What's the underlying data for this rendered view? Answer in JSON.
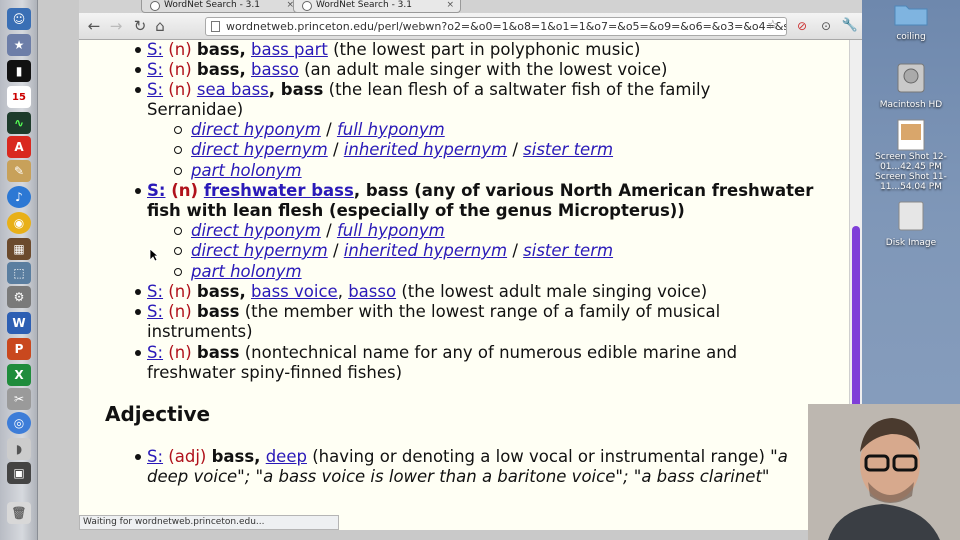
{
  "browser": {
    "tabs": [
      {
        "label": "WordNet Search - 3.1",
        "active": false
      },
      {
        "label": "WordNet Search - 3.1",
        "active": true
      }
    ],
    "url": "wordnetweb.princeton.edu/perl/webwn?o2=&o0=1&o8=1&o1=1&o7=&o5=&o9=&o6=&o3=&o4=&s=bass&i=7&h=00...",
    "status": "Waiting for wordnetweb.princeton.edu..."
  },
  "desktop": {
    "items": [
      {
        "label": "coiling",
        "icon": "folder-icon"
      },
      {
        "label": "Macintosh HD",
        "icon": "hard-drive-icon"
      },
      {
        "label": "Screen Shot 12-01...42.45 PM",
        "icon": "screenshot-icon"
      },
      {
        "label": "Screen Shot 11-11...54.04 PM",
        "icon": "screenshot-icon"
      },
      {
        "label": "Disk Image",
        "icon": "disk-image-icon"
      }
    ]
  },
  "content": {
    "senses": [
      {
        "s": "S:",
        "pos": "(n)",
        "words": "bass,",
        "link": "bass part",
        "gloss": "(the lowest part in polyphonic music)"
      },
      {
        "s": "S:",
        "pos": "(n)",
        "words": "bass,",
        "link": "basso",
        "gloss": "(an adult male singer with the lowest voice)"
      },
      {
        "s": "S:",
        "pos": "(n)",
        "link": "sea bass",
        "words": ", bass",
        "gloss": "(the lean flesh of a saltwater fish of the family",
        "gloss2": "Serranidae)"
      },
      {
        "s": "S:",
        "pos": "(n)",
        "link": "freshwater bass",
        "words": ", bass",
        "gloss": "(any of various North American freshwater",
        "gloss2": "fish with lean flesh (especially of the genus Micropterus))"
      },
      {
        "s": "S:",
        "pos": "(n)",
        "words": "bass,",
        "link": "bass voice",
        "sep": ",",
        "link2": "basso",
        "gloss": "(the lowest adult male singing voice)"
      },
      {
        "s": "S:",
        "pos": "(n)",
        "words": "bass",
        "gloss": "(the member with the lowest range of a family of musical",
        "gloss2": "instruments)"
      },
      {
        "s": "S:",
        "pos": "(n)",
        "words": "bass",
        "gloss": "(nontechnical name for any of numerous edible marine and",
        "gloss2": "freshwater spiny-finned fishes)"
      }
    ],
    "relations": {
      "hyponym_direct": "direct hyponym",
      "hyponym_full": "full hyponym",
      "hypernym_direct": "direct hypernym",
      "hypernym_inherited": "inherited hypernym",
      "sister": "sister term",
      "holonym": "part holonym",
      "divider": "/"
    },
    "adjective_heading": "Adjective",
    "adjective": {
      "s": "S:",
      "pos": "(adj)",
      "words": "bass,",
      "link": "deep",
      "gloss": "(having or denoting a low vocal or instrumental range)",
      "example1": "\"a",
      "example2": "deep voice\"; \"a bass voice is lower than a baritone voice\"; \"a bass clarinet\""
    }
  }
}
